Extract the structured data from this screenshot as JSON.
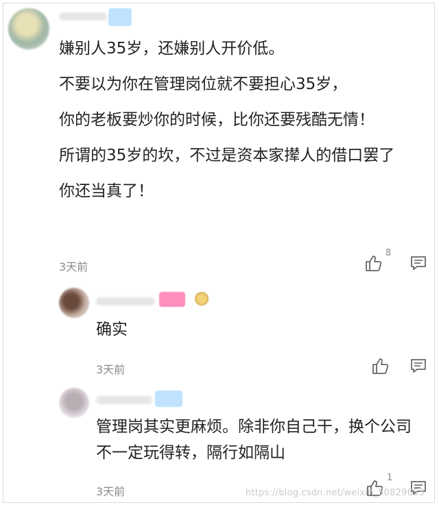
{
  "main_comment": {
    "lines": [
      "嫌别人35岁，还嫌别人开价低。",
      "不要以为你在管理岗位就不要担心35岁，",
      "你的老板要炒你的时候，比你还要残酷无情！",
      "所谓的35岁的坎，不过是资本家撵人的借口罢了",
      "你还当真了！"
    ],
    "time": "3天前",
    "like_count": "8",
    "icons": {
      "like": "thumbs-up-icon",
      "reply": "comment-icon"
    }
  },
  "replies": [
    {
      "text": "确实",
      "time": "3天前",
      "like_count": ""
    },
    {
      "text": "管理岗其实更麻烦。除非你自己干，换个公司不一定玩得转，隔行如隔山",
      "time": "3天前",
      "like_count": "1"
    }
  ],
  "watermark": "https://blog.csdn.net/weixin_50829653",
  "colors": {
    "badge_blue": "#bfe3ff",
    "badge_pink": "#ff8fbd",
    "meta_gray": "#8a8a8a"
  }
}
